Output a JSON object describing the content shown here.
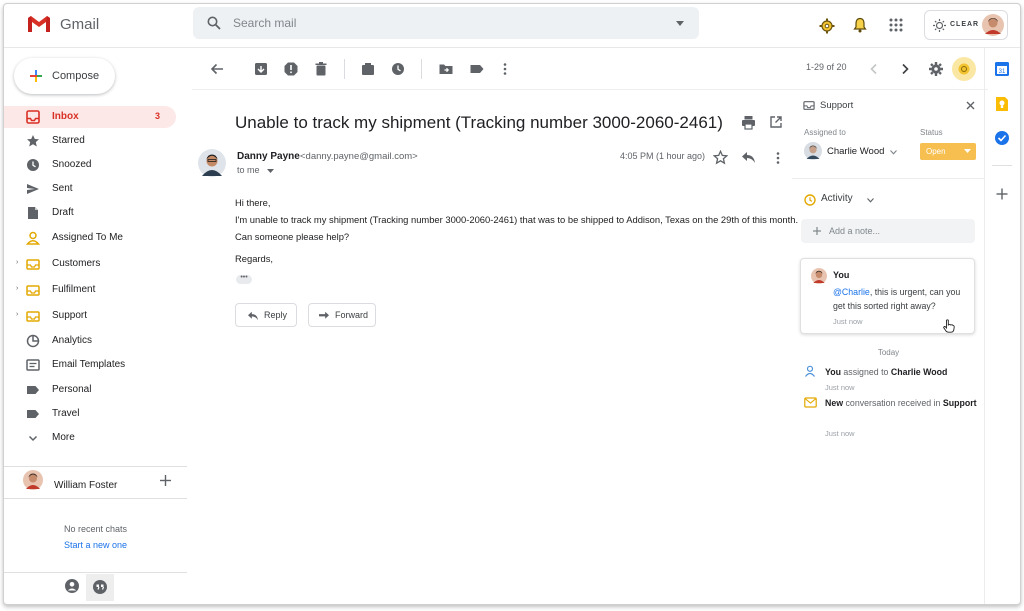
{
  "app": {
    "name": "Gmail"
  },
  "search": {
    "placeholder": "Search mail"
  },
  "header": {
    "addon_label": "CLEAR"
  },
  "compose": {
    "label": "Compose"
  },
  "sidebar": {
    "items": [
      {
        "label": "Inbox",
        "count": "3",
        "icon": "inbox-icon",
        "active": true
      },
      {
        "label": "Starred",
        "icon": "star-icon"
      },
      {
        "label": "Snoozed",
        "icon": "clock-icon"
      },
      {
        "label": "Sent",
        "icon": "send-icon"
      },
      {
        "label": "Draft",
        "icon": "draft-icon"
      },
      {
        "label": "Assigned To Me",
        "icon": "person-icon"
      },
      {
        "label": "Customers",
        "icon": "folder-inbox-icon",
        "expandable": true
      },
      {
        "label": "Fulfilment",
        "icon": "folder-inbox-icon",
        "expandable": true
      },
      {
        "label": "Support",
        "icon": "folder-inbox-icon",
        "expandable": true
      },
      {
        "label": "Analytics",
        "icon": "pie-icon"
      },
      {
        "label": "Email Templates",
        "icon": "template-icon"
      },
      {
        "label": "Personal",
        "icon": "label-icon"
      },
      {
        "label": "Travel",
        "icon": "label-icon"
      },
      {
        "label": "More",
        "icon": "chevron-down-icon"
      }
    ],
    "user": {
      "name": "William Foster"
    },
    "chats": {
      "empty_text": "No recent chats",
      "start_link": "Start a new one"
    }
  },
  "toolbar": {
    "pager": "1-29 of 20"
  },
  "message": {
    "subject": "Unable to track my shipment (Tracking number 3000-2060-2461)",
    "sender_name": "Danny Payne",
    "sender_email": "<danny.payne@gmail.com>",
    "recipient": "to me",
    "time": "4:05 PM (1 hour ago)",
    "body": [
      "Hi there,",
      "I'm unable to track my shipment (Tracking number 3000-2060-2461) that was to be shipped to Addison, Texas on the 29th of this month.",
      "Can someone please help?",
      "Regards,"
    ],
    "reply_label": "Reply",
    "forward_label": "Forward"
  },
  "panel": {
    "title": "Support",
    "assigned_to_label": "Assigned to",
    "assignee": "Charlie Wood",
    "status_label": "Status",
    "status_value": "Open",
    "activity_label": "Activity",
    "note_placeholder": "Add a note...",
    "comment": {
      "author": "You",
      "mention": "@Charlie",
      "text": ", this is urgent, can you get this sorted right away?",
      "time": "Just now"
    },
    "divider_label": "Today",
    "events": [
      {
        "actor": "You",
        "action": " assigned to ",
        "target": "Charlie Wood",
        "time": "Just now"
      },
      {
        "actor": "New",
        "action": " conversation received in ",
        "target": "Support",
        "time": "Just now"
      }
    ]
  },
  "colors": {
    "gmail_red": "#d93025",
    "accent_yellow": "#f6bf4f",
    "link_blue": "#1a73e8"
  }
}
